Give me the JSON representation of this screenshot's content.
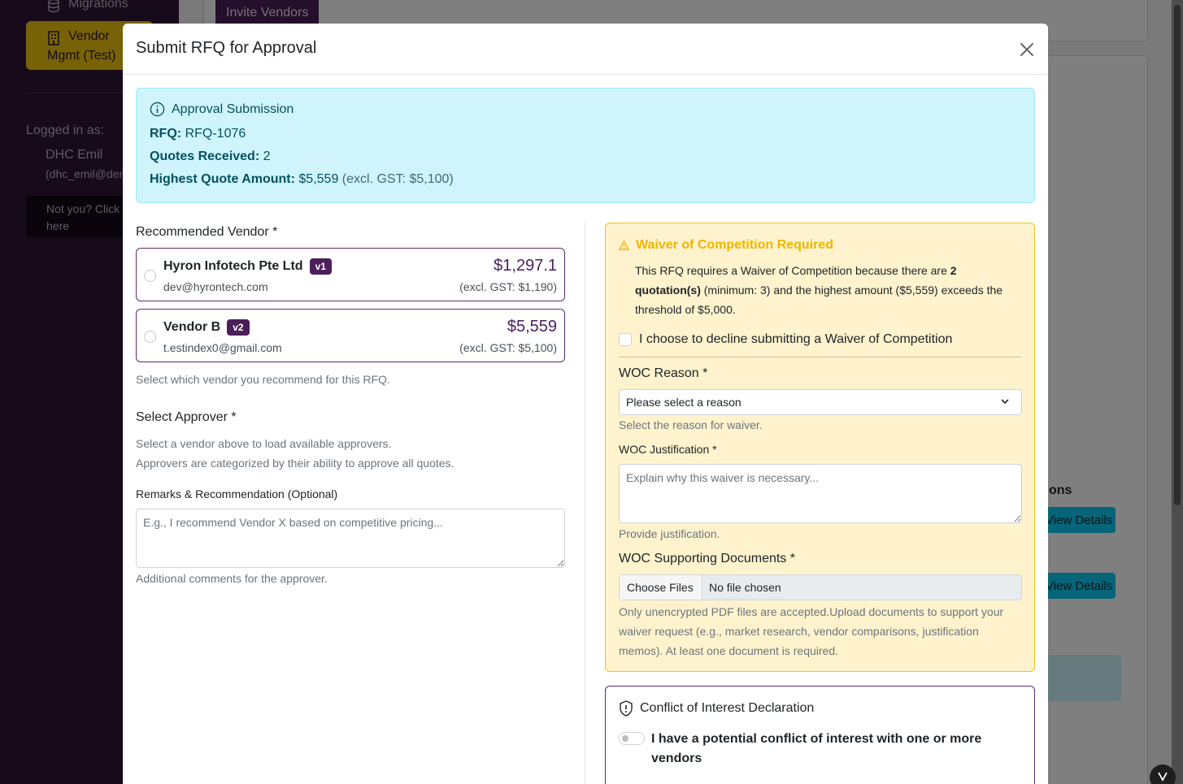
{
  "background": {
    "sidebar": {
      "migrations_label": "Migrations",
      "active_item_line1": "Vendor",
      "active_item_line2": "Mgmt (Test)",
      "logged_in_label": "Logged in as:",
      "user_name": "DHC Emil",
      "user_email": "(dhc_emil@der",
      "not_you_line1": "Not you? Click",
      "not_you_line2": "here"
    },
    "invite_button": "Invite Vendors",
    "actions_header": "ons",
    "view_details_1": "View Details",
    "view_details_2": "View Details"
  },
  "modal": {
    "title": "Submit RFQ for Approval",
    "info": {
      "heading": "Approval Submission",
      "rfq_label": "RFQ:",
      "rfq_value": "RFQ-1076",
      "quotes_label": "Quotes Received:",
      "quotes_value": "2",
      "highest_label": "Highest Quote Amount:",
      "highest_value": "$5,559",
      "highest_excl": "(excl. GST: $5,100)"
    },
    "left": {
      "recommended_label": "Recommended Vendor *",
      "vendors": [
        {
          "name": "Hyron Infotech Pte Ltd",
          "version": "v1",
          "email": "dev@hyrontech.com",
          "price": "$1,297.1",
          "excl": "(excl. GST: $1,190)"
        },
        {
          "name": "Vendor B",
          "version": "v2",
          "email": "t.estindex0@gmail.com",
          "price": "$5,559",
          "excl": "(excl. GST: $5,100)"
        }
      ],
      "vendor_help": "Select which vendor you recommend for this RFQ.",
      "approver_label": "Select Approver *",
      "approver_help_1": "Select a vendor above to load available approvers.",
      "approver_help_2": "Approvers are categorized by their ability to approve all quotes.",
      "remarks_label": "Remarks & Recommendation (Optional)",
      "remarks_placeholder": "E.g., I recommend Vendor X based on competitive pricing...",
      "remarks_help": "Additional comments for the approver."
    },
    "woc": {
      "title": "Waiver of Competition Required",
      "text_pre": "This RFQ requires a Waiver of Competition because there are ",
      "text_bold": "2 quotation(s)",
      "text_post": " (minimum: 3) and the highest amount ($5,559) exceeds the threshold of $5,000.",
      "decline_label": "I choose to decline submitting a Waiver of Competition",
      "reason_label": "WOC Reason *",
      "reason_selected": "Please select a reason",
      "reason_help": "Select the reason for waiver.",
      "justification_label": "WOC Justification *",
      "justification_placeholder": "Explain why this waiver is necessary...",
      "justification_help": "Provide justification.",
      "docs_label": "WOC Supporting Documents *",
      "choose_files": "Choose Files",
      "no_file": "No file chosen",
      "docs_help": "Only unencrypted PDF files are accepted.Upload documents to support your waiver request (e.g., market research, vendor comparisons, justification memos). At least one document is required."
    },
    "coi": {
      "title": "Conflict of Interest Declaration",
      "toggle_label": "I have a potential conflict of interest with one or more vendors"
    }
  },
  "colors": {
    "brand_purple": "#4a1f5a",
    "sidebar_bg": "#2e1437",
    "accent_yellow": "#f1c40f",
    "info_bg": "#cff4fc",
    "warning_bg": "#fff3cd",
    "view_button": "#0dcaf0"
  },
  "icons": {
    "migrations": "database-icon",
    "vendor_mgmt": "building-icon",
    "info": "info-circle-icon",
    "warning": "warning-triangle-icon",
    "shield": "shield-exclamation-icon",
    "close": "close-icon",
    "select": "chevron-down-icon",
    "chat": "chat-logo-icon"
  }
}
